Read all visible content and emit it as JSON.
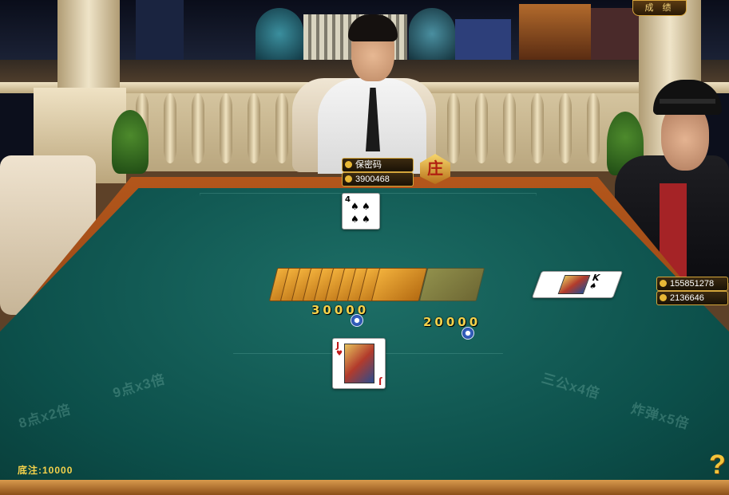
{
  "top_button": {
    "label": "成 绩",
    "icon": "record-icon"
  },
  "dealer": {
    "name": "保密码",
    "chips": "3900468",
    "banker_badge": "庄"
  },
  "player_right": {
    "chips_top": "155851278",
    "chips_bottom": "2136646"
  },
  "bets": {
    "left_amount": "30000",
    "right_amount": "20000"
  },
  "table_text": {
    "left_1": "8点x2倍",
    "left_2": "9点x3倍",
    "right_1": "三公x4倍",
    "right_2": "炸弹x5倍"
  },
  "base_bet": {
    "label": "底注:10000"
  },
  "help": {
    "label": "?"
  },
  "cards": {
    "dealer_card": {
      "rank": "4",
      "suit": "♠"
    },
    "player_right_card": {
      "rank": "K",
      "suit": "♠"
    },
    "my_card": {
      "rank": "J",
      "suit": "♥"
    }
  },
  "colors": {
    "felt": "#0c4f4a",
    "rim": "#b3561b",
    "gold": "#f5d24b"
  }
}
